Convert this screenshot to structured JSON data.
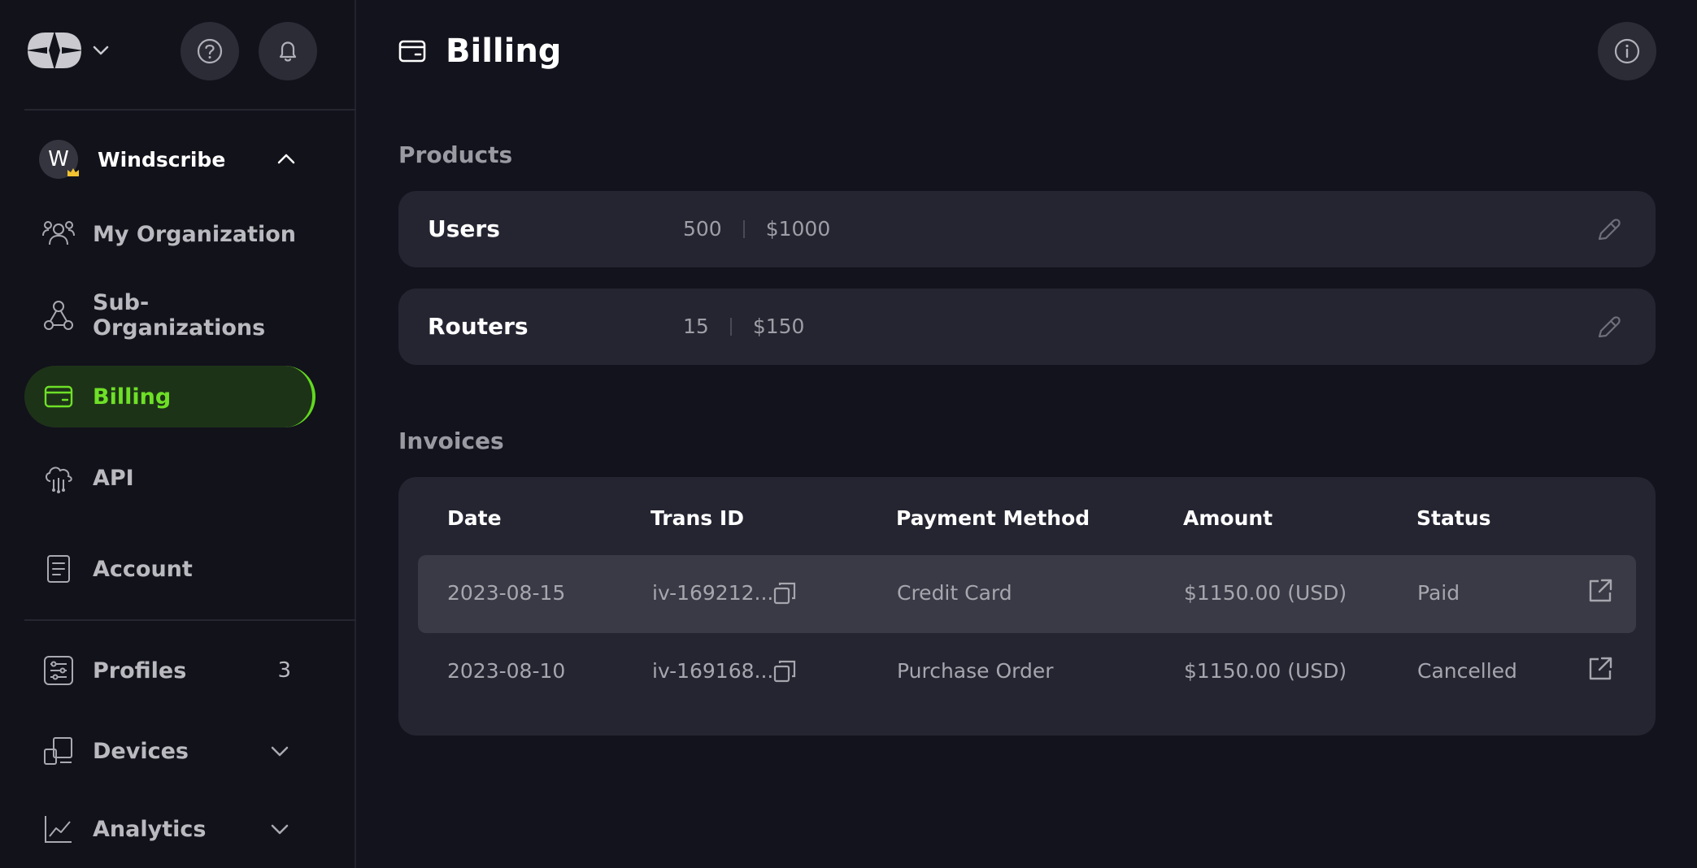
{
  "sidebar": {
    "org": {
      "initial": "W",
      "name": "Windscribe"
    },
    "items": [
      {
        "label": "My Organization",
        "icon": "users-icon"
      },
      {
        "label": "Sub-Organizations",
        "icon": "hierarchy-icon"
      },
      {
        "label": "Billing",
        "icon": "wallet-icon",
        "active": true
      },
      {
        "label": "API",
        "icon": "cloud-api-icon"
      },
      {
        "label": "Account",
        "icon": "document-icon"
      },
      {
        "label": "Profiles",
        "icon": "sliders-icon",
        "count": "3"
      },
      {
        "label": "Devices",
        "icon": "devices-icon"
      },
      {
        "label": "Analytics",
        "icon": "chart-icon"
      }
    ]
  },
  "header": {
    "title": "Billing"
  },
  "products": {
    "title": "Products",
    "items": [
      {
        "name": "Users",
        "quantity": "500",
        "price": "$1000"
      },
      {
        "name": "Routers",
        "quantity": "15",
        "price": "$150"
      }
    ]
  },
  "invoices": {
    "title": "Invoices",
    "columns": [
      "Date",
      "Trans ID",
      "Payment Method",
      "Amount",
      "Status"
    ],
    "rows": [
      {
        "date": "2023-08-15",
        "trans_id": "iv-169212...",
        "method": "Credit Card",
        "amount": "$1150.00 (USD)",
        "status": "Paid"
      },
      {
        "date": "2023-08-10",
        "trans_id": "iv-169168...",
        "method": "Purchase Order",
        "amount": "$1150.00 (USD)",
        "status": "Cancelled"
      }
    ]
  },
  "colors": {
    "accent": "#61d91f",
    "card": "#252532",
    "background": "#13131d"
  }
}
